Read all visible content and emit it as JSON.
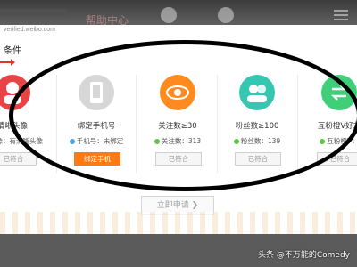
{
  "header": {
    "title": "帮助中心"
  },
  "panel": {
    "url": "verified.weibo.com",
    "section_title": "条件"
  },
  "cards": [
    {
      "label": "清晰头像",
      "status": "头像：有清晰头像",
      "button": "已符合",
      "color": "#e94346",
      "icon": "avatar-icon"
    },
    {
      "label": "绑定手机号",
      "status": "手机号：未绑定",
      "button": "绑定手机",
      "color": "#d7d7d7",
      "icon": "phone-icon"
    },
    {
      "label": "关注数≥30",
      "status": "关注数：313",
      "button": "已符合",
      "color": "#ff8a1f",
      "icon": "eye-icon"
    },
    {
      "label": "粉丝数≥100",
      "status": "粉丝数：139",
      "button": "已符合",
      "color": "#35c7b0",
      "icon": "users-icon"
    },
    {
      "label": "互粉橙V好友",
      "status": "互粉橙V：",
      "button": "已符合",
      "color": "#3fcf79",
      "icon": "swap-icon"
    }
  ],
  "apply": {
    "label": "立即申请 ❯"
  },
  "watermark": "头条 @不万能的Comedy"
}
